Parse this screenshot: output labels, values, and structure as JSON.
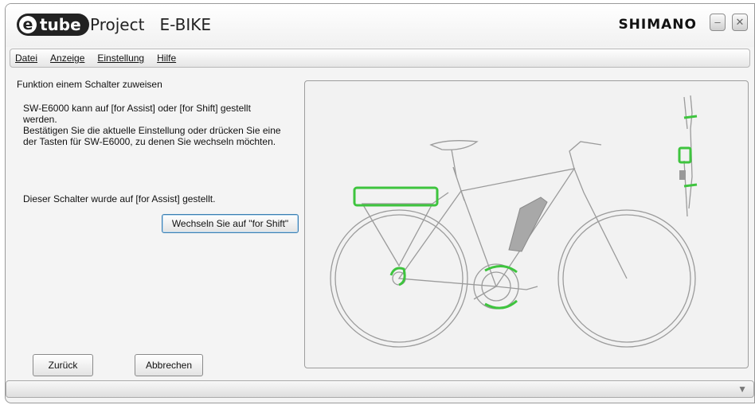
{
  "window": {
    "logo_e": "e",
    "logo_text": "tube",
    "app_title": "Project   E-BIKE",
    "brand": "SHIMANO",
    "minimize_glyph": "–",
    "close_glyph": "✕"
  },
  "menu": {
    "items": [
      "Datei",
      "Anzeige",
      "Einstellung",
      "Hilfe"
    ]
  },
  "panel": {
    "heading": "Funktion einem Schalter zuweisen",
    "description": "SW-E6000 kann auf [for Assist] oder [for Shift] gestellt werden.\nBestätigen Sie die aktuelle Einstellung oder drücken Sie eine der Tasten für SW-E6000, zu denen Sie wechseln möchten.",
    "status": "Dieser Schalter wurde auf [for Assist] gestellt.",
    "switch_button": "Wechseln Sie auf \"for Shift\"",
    "back_button": "Zurück",
    "cancel_button": "Abbrechen"
  },
  "icons": {
    "statusbar": "filter-icon",
    "statusbar_glyph": "▼"
  },
  "colors": {
    "highlight_green": "#3ec43e",
    "bike_outline": "#9b9b9b",
    "battery_gray": "#a8a8a8"
  }
}
